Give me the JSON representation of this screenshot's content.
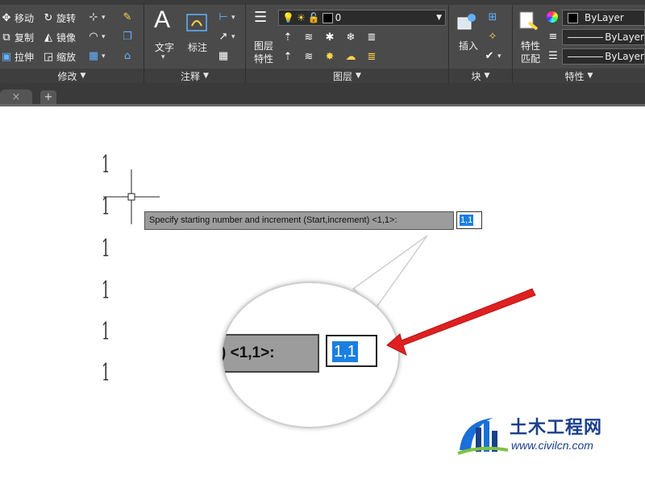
{
  "ribbon": {
    "modify_panel": {
      "title": "修改",
      "tools": [
        {
          "label": "移动",
          "icon": "move-icon"
        },
        {
          "label": "旋转",
          "icon": "rotate-icon"
        },
        {
          "label": "复制",
          "icon": "copy-icon"
        },
        {
          "label": "镜像",
          "icon": "mirror-icon"
        },
        {
          "label": "拉伸",
          "icon": "stretch-icon"
        },
        {
          "label": "缩放",
          "icon": "scale-icon"
        }
      ]
    },
    "annotation_panel": {
      "title": "注释",
      "text_label": "文字",
      "dimension_label": "标注"
    },
    "layers_panel": {
      "title": "图层",
      "properties_label_line1": "图层",
      "properties_label_line2": "特性",
      "current_layer": "0"
    },
    "block_panel": {
      "title": "块",
      "insert_label": "插入"
    },
    "properties_panel": {
      "title": "特性",
      "match_label_line1": "特性",
      "match_label_line2": "匹配",
      "color_value": "ByLayer",
      "linetype_value": "ByLayer",
      "lineweight_value": "ByLayer"
    }
  },
  "tabs": {
    "close_glyph": "×",
    "new_tab_glyph": "+"
  },
  "canvas": {
    "sequence_numbers": [
      "1",
      "1",
      "1",
      "1",
      "1",
      "1"
    ],
    "prompt_text": "Specify starting number and increment (Start,increment) <1,1>:",
    "input_value": "1,1"
  },
  "magnifier": {
    "prompt_fragment": ") <1,1>:",
    "input_value": "1,1"
  },
  "watermark": {
    "title": "土木工程网",
    "url": "www.civilcn.com"
  },
  "colors": {
    "ribbon_bg": "#4a4a4a",
    "highlight_blue": "#1a7fe0",
    "arrow_red": "#e02020",
    "watermark_blue": "#1b3f8c"
  }
}
